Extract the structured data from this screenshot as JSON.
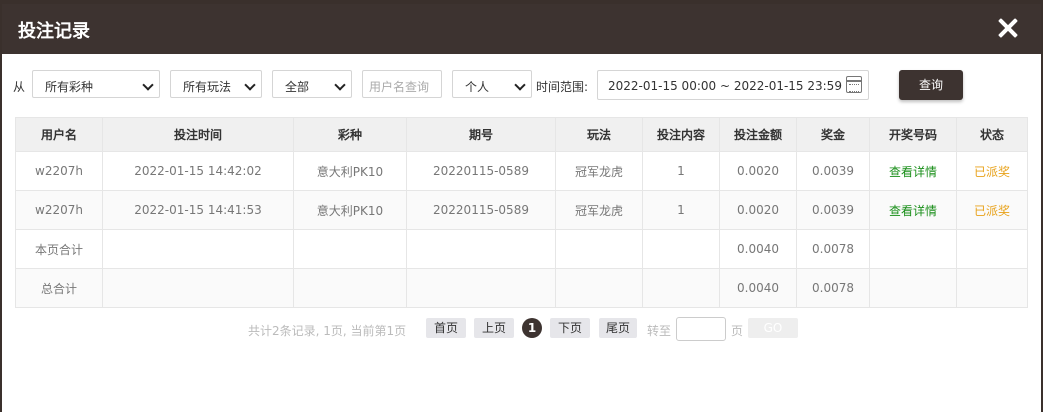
{
  "dialog": {
    "title": "投注记录"
  },
  "filters": {
    "from_label": "从",
    "lottery_select": "所有彩种",
    "play_select": "所有玩法",
    "status_select": "全部",
    "username_placeholder": "用户名查询",
    "scope_select": "个人",
    "range_label": "时间范围:",
    "range_value": "2022-01-15 00:00 ~ 2022-01-15 23:59",
    "query_button": "查询"
  },
  "table": {
    "columns": [
      "用户名",
      "投注时间",
      "彩种",
      "期号",
      "玩法",
      "投注内容",
      "投注金额",
      "奖金",
      "开奖号码",
      "状态"
    ],
    "rows": [
      {
        "user": "w2207h",
        "time": "2022-01-15 14:42:02",
        "lottery": "意大利PK10",
        "issue": "20220115-0589",
        "play": "冠军龙虎",
        "content": "1",
        "amount": "0.0020",
        "prize": "0.0039",
        "draw": "查看详情",
        "status": "已派奖"
      },
      {
        "user": "w2207h",
        "time": "2022-01-15 14:41:53",
        "lottery": "意大利PK10",
        "issue": "20220115-0589",
        "play": "冠军龙虎",
        "content": "1",
        "amount": "0.0020",
        "prize": "0.0039",
        "draw": "查看详情",
        "status": "已派奖"
      }
    ],
    "page_total": {
      "label": "本页合计",
      "amount": "0.0040",
      "prize": "0.0078"
    },
    "grand_total": {
      "label": "总合计",
      "amount": "0.0040",
      "prize": "0.0078"
    }
  },
  "pagination": {
    "info": "共计2条记录, 1页, 当前第1页",
    "first": "首页",
    "prev": "上页",
    "current": "1",
    "next": "下页",
    "last": "尾页",
    "goto_label": "转至",
    "page_unit": "页",
    "go_button": "GO"
  },
  "colors": {
    "header_bg": "#3d3330",
    "link_green": "#1a8f1a",
    "status_orange": "#e8a21a"
  },
  "icons": {
    "close": "close-icon",
    "calendar": "calendar-icon",
    "chevron": "chevron-down-icon"
  }
}
